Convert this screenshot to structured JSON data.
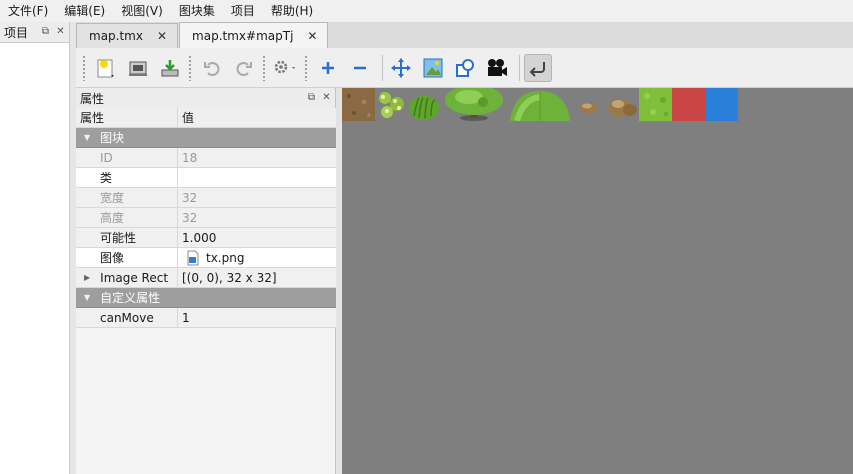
{
  "menu": [
    "文件(F)",
    "编辑(E)",
    "视图(V)",
    "图块集",
    "项目",
    "帮助(H)"
  ],
  "projects_dock": {
    "title": "项目"
  },
  "tabs": [
    {
      "label": "map.tmx",
      "active": false
    },
    {
      "label": "map.tmx#mapTj",
      "active": true
    }
  ],
  "toolbar": {
    "icons": [
      "new-tileset-icon",
      "open-icon",
      "export-icon",
      "undo-icon",
      "redo-icon",
      "tileset-settings-icon",
      "add-tile-icon",
      "remove-tile-icon",
      "rearrange-tiles-icon",
      "edit-image-icon",
      "edit-collision-icon",
      "animation-icon",
      "dynamic-wrapping-icon"
    ]
  },
  "properties": {
    "title": "属性",
    "columns": {
      "name": "属性",
      "value": "值"
    },
    "tile_group": "图块",
    "rows": [
      {
        "name": "ID",
        "value": "18"
      },
      {
        "name": "类",
        "value": ""
      },
      {
        "name": "宽度",
        "value": "32"
      },
      {
        "name": "高度",
        "value": "32"
      },
      {
        "name": "可能性",
        "value": "1.000"
      },
      {
        "name": "图像",
        "value": "tx.png"
      },
      {
        "name": "Image Rect",
        "value": "[(0, 0), 32 x 32]"
      }
    ],
    "custom_group": "自定义属性",
    "custom_rows": [
      {
        "name": "canMove",
        "value": "1"
      }
    ]
  },
  "colors": {
    "canvas_bg": "#7f7f7f",
    "group_row": "#9e9e9e",
    "tile_red": "#c94545",
    "tile_blue": "#2a7fd8",
    "tile_grass": "#7fbf3a"
  }
}
